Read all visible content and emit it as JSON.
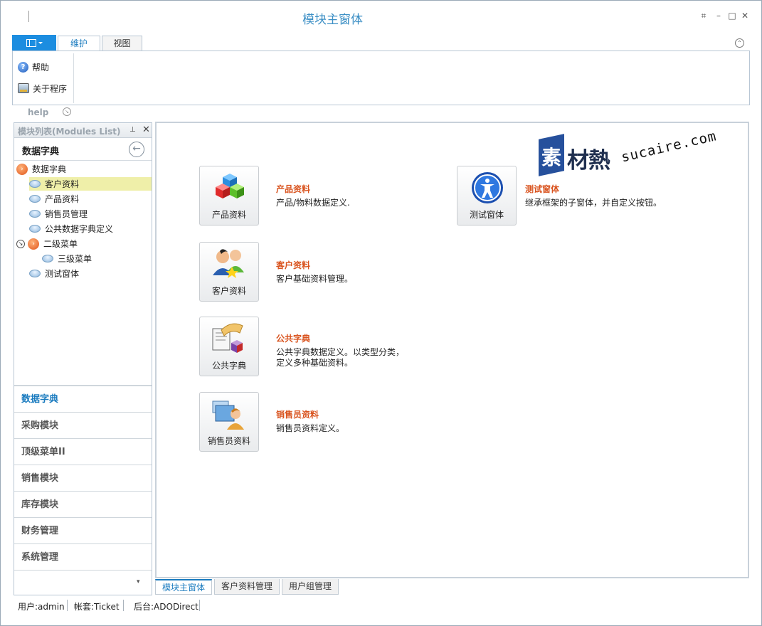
{
  "window": {
    "title": "模块主窗体"
  },
  "ribbon": {
    "tabs": [
      {
        "label": "维护"
      },
      {
        "label": "视图"
      }
    ],
    "buttons": [
      {
        "label": "帮助"
      },
      {
        "label": "关于程序"
      }
    ],
    "group_label": "help"
  },
  "modules_panel": {
    "title": "模块列表(Modules List)",
    "group_title": "数据字典",
    "tree": [
      {
        "label": "数据字典"
      },
      {
        "label": "客户资料"
      },
      {
        "label": "产品资料"
      },
      {
        "label": "销售员管理"
      },
      {
        "label": "公共数据字典定义"
      },
      {
        "label": "二级菜单"
      },
      {
        "label": "三级菜单"
      },
      {
        "label": "测试窗体"
      }
    ],
    "nav": [
      {
        "label": "数据字典"
      },
      {
        "label": "采购模块"
      },
      {
        "label": "顶级菜单II"
      },
      {
        "label": "销售模块"
      },
      {
        "label": "库存模块"
      },
      {
        "label": "财务管理"
      },
      {
        "label": "系统管理"
      }
    ]
  },
  "main": {
    "items": [
      {
        "tile_label": "产品资料",
        "title": "产品资料",
        "desc": "产品/物料数据定义."
      },
      {
        "tile_label": "客户资料",
        "title": "客户资料",
        "desc": "客户基础资料管理。"
      },
      {
        "tile_label": "公共字典",
        "title": "公共字典",
        "desc": "公共字典数据定义。以类型分类，\n定义多种基础资料。"
      },
      {
        "tile_label": "销售员资料",
        "title": "销售员资料",
        "desc": "销售员资料定义。"
      },
      {
        "tile_label": "测试窗体",
        "title": "测试窗体",
        "desc": "继承框架的子窗体，并自定义按钮。"
      }
    ],
    "watermark": {
      "char": "素",
      "text": "材熱",
      "url": "sucaire.com"
    }
  },
  "doc_tabs": [
    {
      "label": "模块主窗体"
    },
    {
      "label": "客户资料管理"
    },
    {
      "label": "用户组管理"
    }
  ],
  "status_bar": [
    {
      "text": "用户:admin"
    },
    {
      "text": "帐套:Ticket"
    },
    {
      "text": "后台:ADODirect"
    }
  ]
}
